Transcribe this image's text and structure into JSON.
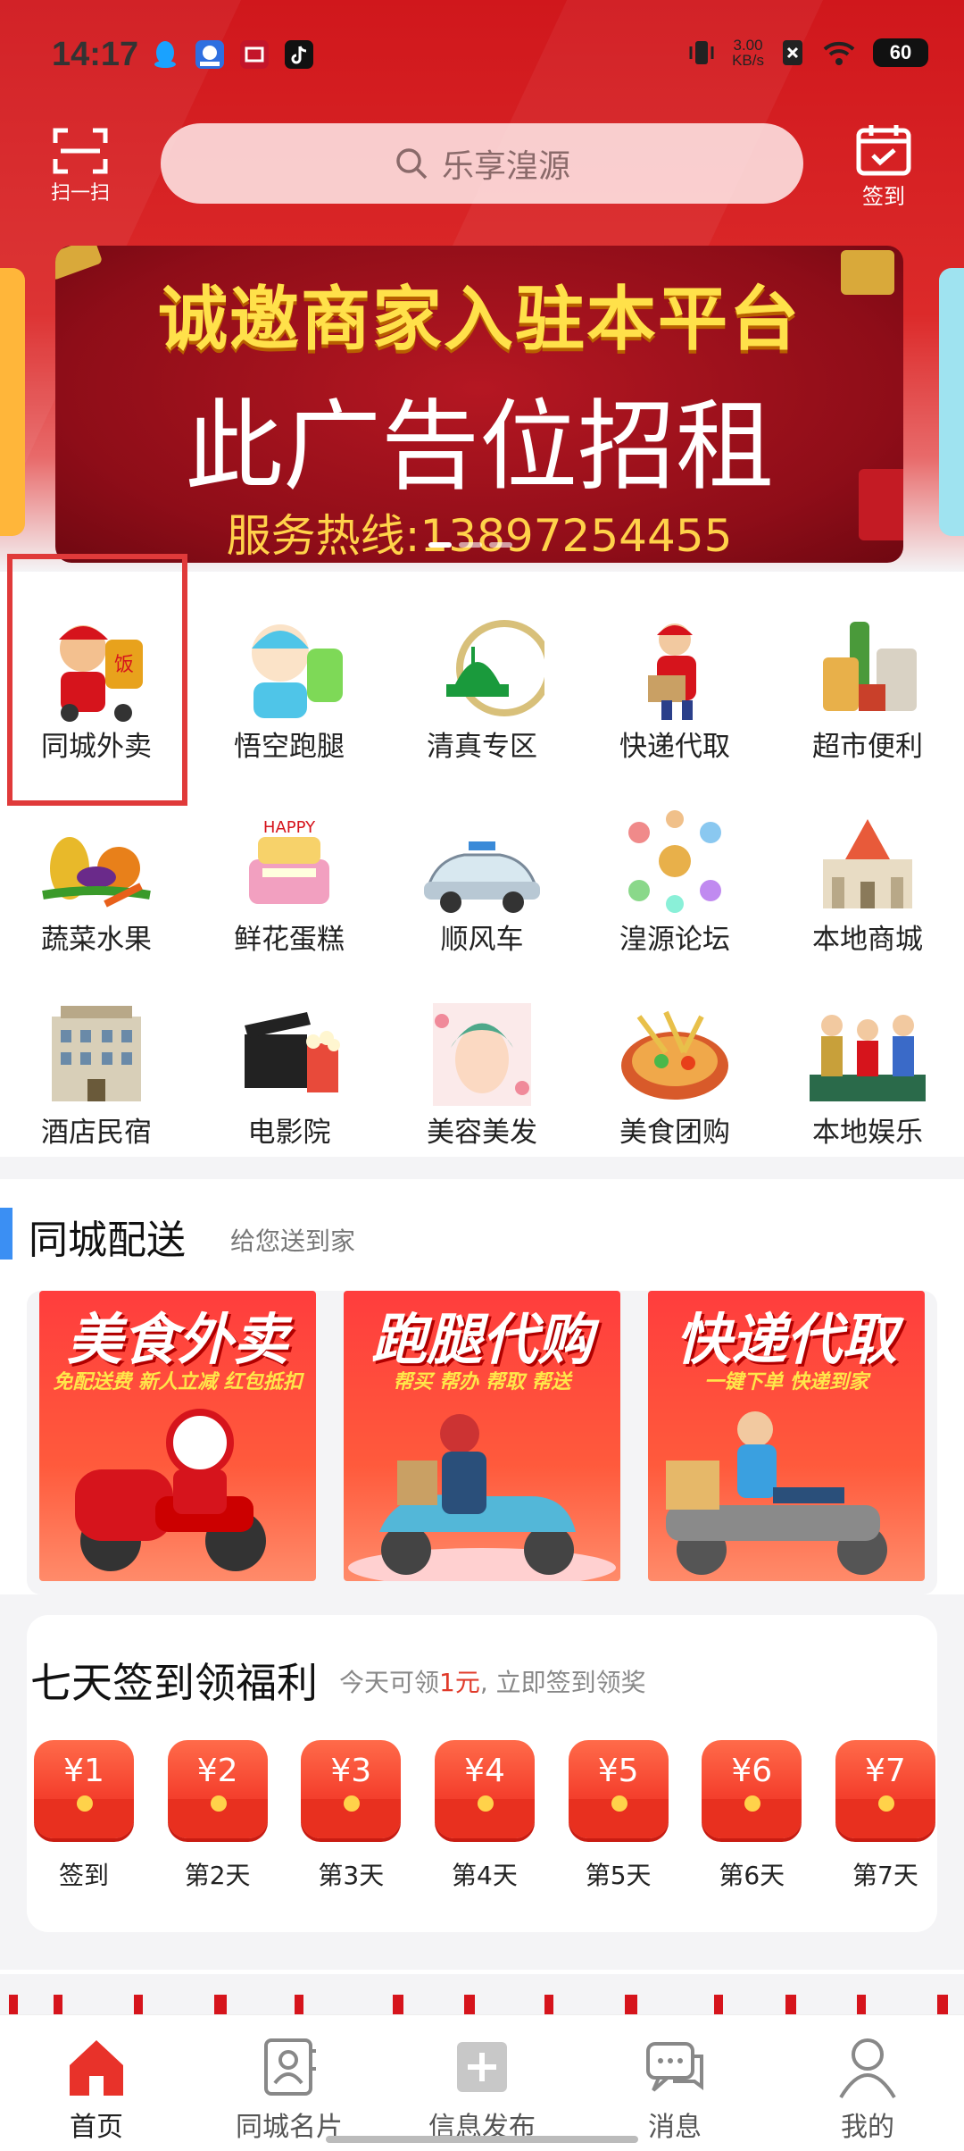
{
  "status_bar": {
    "time": "14:17",
    "net_speed_value": "3.00",
    "net_speed_unit": "KB/s",
    "battery": "60"
  },
  "top_bar": {
    "scan_label": "扫一扫",
    "search_placeholder": "乐享湟源",
    "signin_label": "签到"
  },
  "banner": {
    "headline": "诚邀商家入驻本平台",
    "main_text": "此广告位招租",
    "hotline": "服务热线:13897254455"
  },
  "categories": [
    {
      "label": "同城外卖",
      "icon": "takeout-icon"
    },
    {
      "label": "悟空跑腿",
      "icon": "errand-icon"
    },
    {
      "label": "清真专区",
      "icon": "halal-icon"
    },
    {
      "label": "快递代取",
      "icon": "courier-icon"
    },
    {
      "label": "超市便利",
      "icon": "supermarket-icon"
    },
    {
      "label": "蔬菜水果",
      "icon": "vegetables-icon"
    },
    {
      "label": "鲜花蛋糕",
      "icon": "cake-icon"
    },
    {
      "label": "顺风车",
      "icon": "car-icon"
    },
    {
      "label": "湟源论坛",
      "icon": "forum-icon"
    },
    {
      "label": "本地商城",
      "icon": "mall-icon"
    },
    {
      "label": "酒店民宿",
      "icon": "hotel-icon"
    },
    {
      "label": "电影院",
      "icon": "cinema-icon"
    },
    {
      "label": "美容美发",
      "icon": "beauty-icon"
    },
    {
      "label": "美食团购",
      "icon": "food-icon"
    },
    {
      "label": "本地娱乐",
      "icon": "entertainment-icon"
    }
  ],
  "delivery_section": {
    "title": "同城配送",
    "subtitle": "给您送到家",
    "promos": [
      {
        "title": "美食外卖",
        "tagline": "免配送费 新人立减 红包抵扣"
      },
      {
        "title": "跑腿代购",
        "tagline": "帮买 帮办 帮取 帮送"
      },
      {
        "title": "快递代取",
        "tagline": "一键下单 快递到家"
      }
    ]
  },
  "signin_section": {
    "title": "七天签到领福利",
    "subtitle_prefix": "今天可领",
    "subtitle_amount": "1元",
    "subtitle_suffix": ", 立即签到领奖",
    "days": [
      {
        "amount": "¥1",
        "label": "签到"
      },
      {
        "amount": "¥2",
        "label": "第2天"
      },
      {
        "amount": "¥3",
        "label": "第3天"
      },
      {
        "amount": "¥4",
        "label": "第4天"
      },
      {
        "amount": "¥5",
        "label": "第5天"
      },
      {
        "amount": "¥6",
        "label": "第6天"
      },
      {
        "amount": "¥7",
        "label": "第7天"
      }
    ]
  },
  "tabbar": {
    "items": [
      {
        "label": "首页",
        "icon": "home-icon",
        "active": true
      },
      {
        "label": "同城名片",
        "icon": "card-icon",
        "active": false
      },
      {
        "label": "信息发布",
        "icon": "publish-icon",
        "active": false
      },
      {
        "label": "消息",
        "icon": "message-icon",
        "active": false
      },
      {
        "label": "我的",
        "icon": "profile-icon",
        "active": false
      }
    ]
  },
  "colors": {
    "brand_red": "#d0171c",
    "accent_blue": "#3b8ff3",
    "highlight_border": "#e03a3a"
  }
}
